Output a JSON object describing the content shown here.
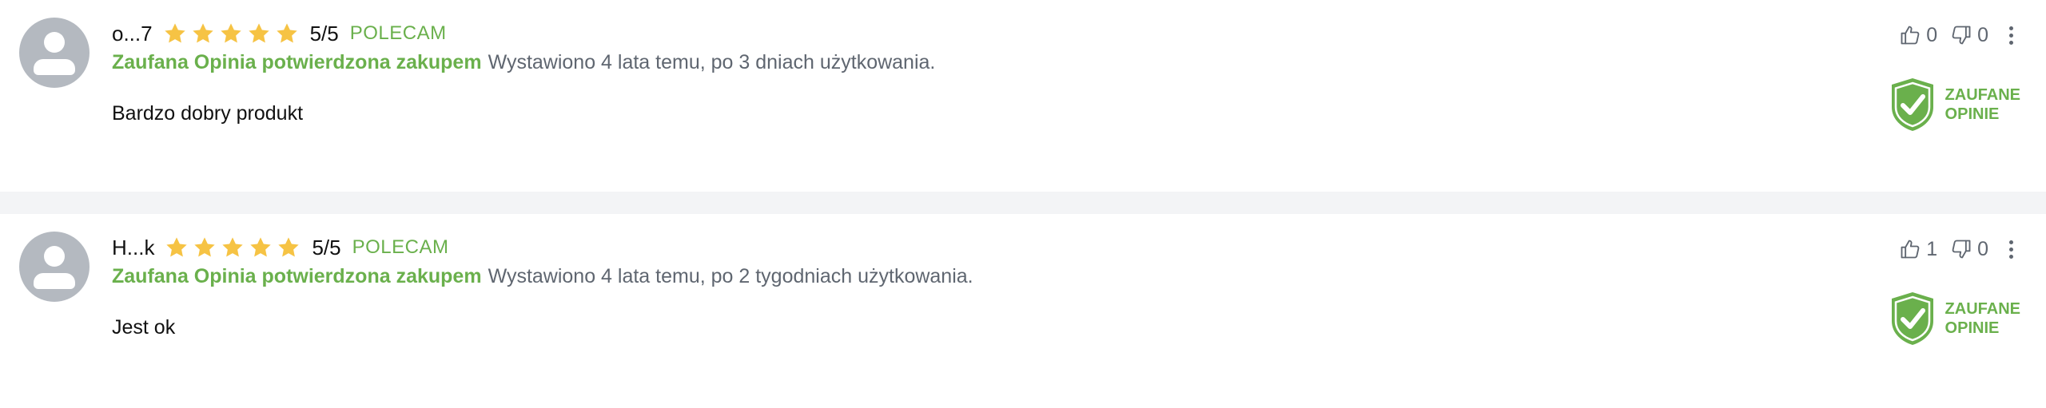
{
  "colors": {
    "accent_green": "#6ab04c",
    "star_yellow": "#f6c344",
    "meta_gray": "#5f6670",
    "avatar_gray": "#b4b9c0",
    "separator": "#f3f4f6"
  },
  "icons": {
    "avatar": "user-avatar-icon",
    "star": "star-icon",
    "thumbs_up": "thumbs-up-icon",
    "thumbs_down": "thumbs-down-icon",
    "more": "more-vertical-icon",
    "badge": "shield-check-icon"
  },
  "reviews": [
    {
      "author": "o...7",
      "rating": 5,
      "score": "5/5",
      "verdict": "POLECAM",
      "verified_label": "Zaufana Opinia potwierdzona zakupem",
      "meta": "Wystawiono 4 lata temu, po 3 dniach użytkowania.",
      "content": "Bardzo dobry produkt",
      "likes": "0",
      "dislikes": "0",
      "badge_line1": "ZAUFANE",
      "badge_line2": "OPINIE"
    },
    {
      "author": "H...k",
      "rating": 5,
      "score": "5/5",
      "verdict": "POLECAM",
      "verified_label": "Zaufana Opinia potwierdzona zakupem",
      "meta": "Wystawiono 4 lata temu, po 2 tygodniach użytkowania.",
      "content": "Jest ok",
      "likes": "1",
      "dislikes": "0",
      "badge_line1": "ZAUFANE",
      "badge_line2": "OPINIE"
    }
  ]
}
